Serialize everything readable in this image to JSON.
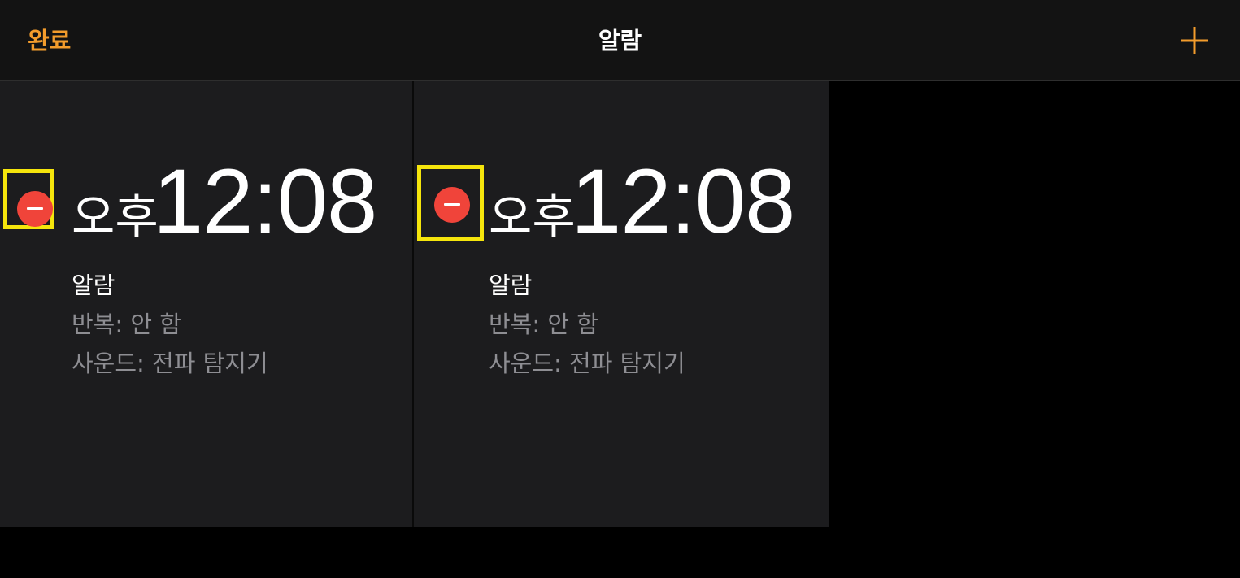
{
  "navbar": {
    "done_label": "완료",
    "title": "알람",
    "add_icon": "plus-icon"
  },
  "alarms": [
    {
      "ampm": "오후",
      "time": "12:08",
      "label": "알람",
      "repeat": "반복: 안 함",
      "sound": "사운드: 전파 탐지기",
      "delete_icon": "minus-circle-icon"
    },
    {
      "ampm": "오후",
      "time": "12:08",
      "label": "알람",
      "repeat": "반복: 안 함",
      "sound": "사운드: 전파 탐지기",
      "delete_icon": "minus-circle-icon"
    }
  ],
  "colors": {
    "accent": "#f39c2c",
    "delete": "#f0443a",
    "highlight": "#f5e50c",
    "card_bg": "#1c1c1e",
    "secondary_text": "#8e8e93"
  }
}
